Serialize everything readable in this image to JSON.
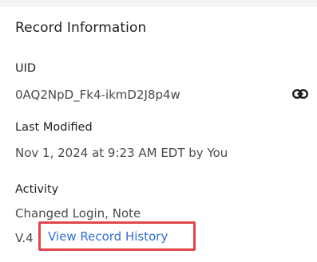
{
  "section": {
    "title": "Record Information"
  },
  "uid": {
    "label": "UID",
    "value": "0AQ2NpD_Fk4-ikmD2J8p4w",
    "copy_icon": "link-icon"
  },
  "last_modified": {
    "label": "Last Modified",
    "value": "Nov 1, 2024 at 9:23 AM EDT by You"
  },
  "activity": {
    "label": "Activity",
    "value": "Changed Login, Note",
    "version": "V.4",
    "history_link": "View Record History"
  },
  "colors": {
    "link": "#2f6fd6",
    "highlight": "#e2444c",
    "text_primary": "#1f1f1f",
    "text_secondary": "#4a4a4a"
  }
}
